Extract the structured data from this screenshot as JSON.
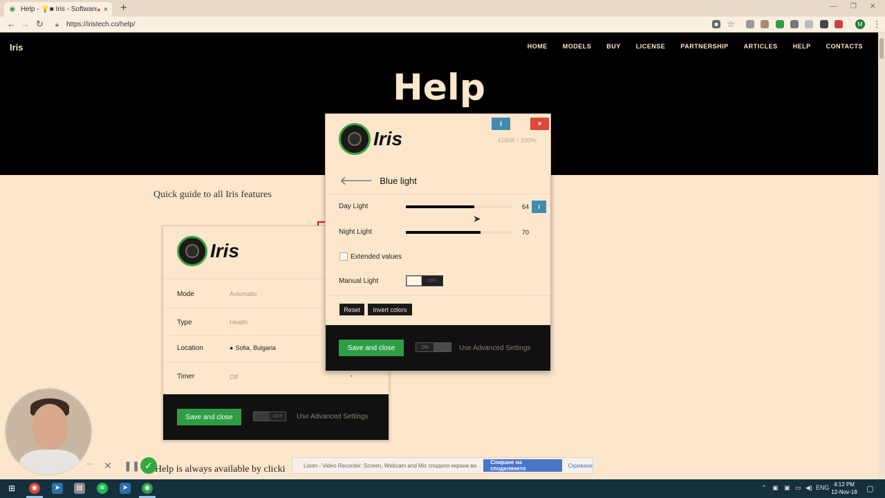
{
  "browser": {
    "tabs": [
      {
        "label": "Help - 💡■ Iris - Software f",
        "active": true
      },
      {
        "label": "+",
        "active": false
      }
    ],
    "url": "https://iristech.co/help/"
  },
  "site": {
    "logo": "Iris",
    "nav": [
      "HOME",
      "MODELS",
      "BUY",
      "LICENSE",
      "PARTNERSHIP",
      "ARTICLES",
      "HELP",
      "CONTACTS"
    ],
    "hero_title": "Help",
    "guide_text": "Quick guide to all Iris features",
    "bottom_text": "Help is always available by clicking on one of the blue buttons in any application",
    "bottom_text_visible": "Help is always available by clicki"
  },
  "iris_background": {
    "logo_text": "Iris",
    "rows": [
      {
        "label": "Mode",
        "value": "Automatic"
      },
      {
        "label": "Type",
        "value": "Health"
      },
      {
        "label": "Location",
        "value": "Sofia, Bulgaria"
      },
      {
        "label": "Timer",
        "value": "Off"
      }
    ],
    "save_label": "Save and close",
    "toggle_state": "OFF",
    "advanced_label": "Use Advanced Settings"
  },
  "iris_foreground": {
    "logo_text": "Iris",
    "info_btn": "i",
    "min_btn": "_",
    "close_btn": "×",
    "stats": "4160K / 100%",
    "back_label": "Blue light",
    "day_light": {
      "label": "Day Light",
      "value": "64",
      "fraction": 0.64
    },
    "night_light": {
      "label": "Night Light",
      "value": "70",
      "fraction": 0.7
    },
    "extended_label": "Extended values",
    "manual_label": "Manual Light",
    "manual_state": "OFF",
    "reset_label": "Reset",
    "invert_label": "Invert colors",
    "save_label": "Save and close",
    "toggle_state": "ON",
    "advanced_label": "Use Advanced Settings"
  },
  "loom": {
    "message": "Loom - Video Recorder: Screen, Webcam and Mic споделя екрана ви.",
    "stop_label": "Спиране на споделянето",
    "hide_label": "Скриване"
  },
  "taskbar": {
    "lang": "ENG",
    "time": "4:12 PM",
    "date": "12-Nov-18"
  },
  "colors": {
    "accent_green": "#2e9e44",
    "info_blue": "#3f8cb0",
    "close_red": "#e0463c",
    "page_bg": "#fde7cc"
  }
}
